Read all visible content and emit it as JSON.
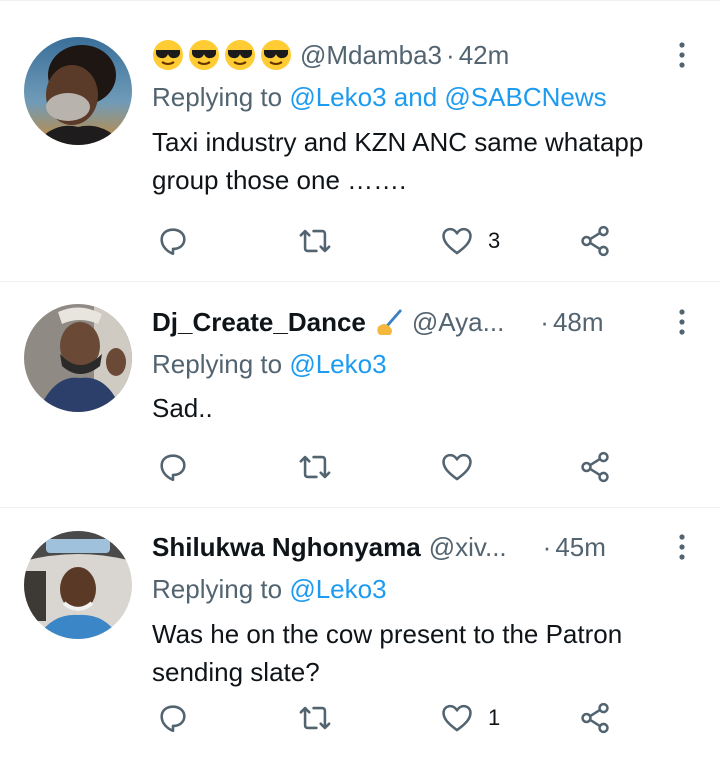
{
  "tweets": [
    {
      "display_name": "",
      "name_emojis": [
        "smiling-face-with-sunglasses",
        "smiling-face-with-sunglasses",
        "smiling-face-with-sunglasses",
        "smiling-face-with-sunglasses"
      ],
      "handle": "@Mdamba3",
      "separator": "·",
      "time": "42m",
      "replying_prefix": "Replying to",
      "replying_mentions": [
        "@Leko3",
        "@SABCNews"
      ],
      "replying_joiner": "and",
      "text": "Taxi industry and KZN ANC same whatapp group those one …….",
      "reply_count": "",
      "retweet_count": "",
      "like_count": "3",
      "icons": {
        "more": "more-vertical-icon",
        "reply": "reply-icon",
        "retweet": "retweet-icon",
        "like": "heart-icon",
        "share": "share-icon"
      }
    },
    {
      "display_name": "Dj_Create_Dance",
      "name_emoji": "writing-hand",
      "handle": "@Aya...",
      "separator": "·",
      "time": "48m",
      "replying_prefix": "Replying to",
      "replying_mentions": [
        "@Leko3"
      ],
      "text": "Sad..",
      "like_count": ""
    },
    {
      "display_name": "Shilukwa Nghonyama",
      "handle": "@xiv...",
      "separator": "·",
      "time": "45m",
      "replying_prefix": "Replying to",
      "replying_mentions": [
        "@Leko3"
      ],
      "text": "Was he on the cow present to the Patron sending slate?",
      "like_count": "1"
    }
  ],
  "colors": {
    "text": "#0f1419",
    "secondary": "#536471",
    "mention": "#1d9bf0",
    "divider": "#eff3f4"
  }
}
